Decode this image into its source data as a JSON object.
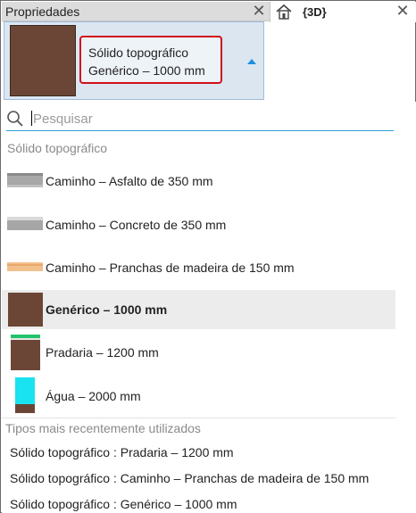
{
  "panel": {
    "title": "Propriedades",
    "close_glyph": "✕"
  },
  "view_tab": {
    "label": "{3D}",
    "icon": "home-icon",
    "close_glyph": "✕"
  },
  "type_selector": {
    "family": "Sólido topográfico",
    "type": "Genérico – 1000 mm",
    "swatch_color": "#6b4636",
    "highlight_color": "#d0101b"
  },
  "dropdown": {
    "search_placeholder": "Pesquisar",
    "search_value": "",
    "group_header": "Sólido topográfico",
    "items": [
      {
        "label": "Caminho – Asfalto de 350 mm",
        "material": "asfalto",
        "selected": false
      },
      {
        "label": "Caminho – Concreto de 350 mm",
        "material": "concreto",
        "selected": false
      },
      {
        "label": "Caminho – Pranchas de madeira de 150 mm",
        "material": "madeira",
        "selected": false
      },
      {
        "label": "Genérico – 1000 mm",
        "material": "generico",
        "selected": true
      },
      {
        "label": "Pradaria – 1200 mm",
        "material": "pradaria",
        "selected": false
      },
      {
        "label": "Água – 2000 mm",
        "material": "agua",
        "selected": false
      }
    ],
    "recent_header": "Tipos mais recentemente utilizados",
    "recent": [
      "Sólido topográfico : Pradaria – 1200 mm",
      "Sólido topográfico : Caminho – Pranchas de madeira de 150 mm",
      "Sólido topográfico : Genérico – 1000 mm"
    ]
  },
  "colors": {
    "accent": "#2d9fd6",
    "selected_row": "#ececec",
    "soil": "#6b4636",
    "water": "#19e3f0",
    "grass": "#22c36b",
    "wood": "#f2c08c"
  }
}
